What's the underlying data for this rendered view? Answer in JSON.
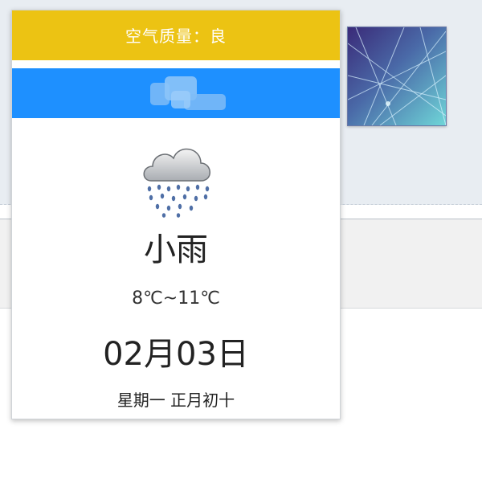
{
  "popup": {
    "air_quality": "空气质量：良",
    "city": "",
    "weather_icon": "light-rain-cloud-icon",
    "condition": "小雨",
    "temperature": "8℃~11℃",
    "date": "02月03日",
    "weekday_lunar": "星期一 正月初十"
  },
  "colors": {
    "air_quality_bar": "#ecc313",
    "city_bar": "#1e90ff"
  },
  "background": {
    "thumbnail": "abstract-light-lines-image"
  }
}
